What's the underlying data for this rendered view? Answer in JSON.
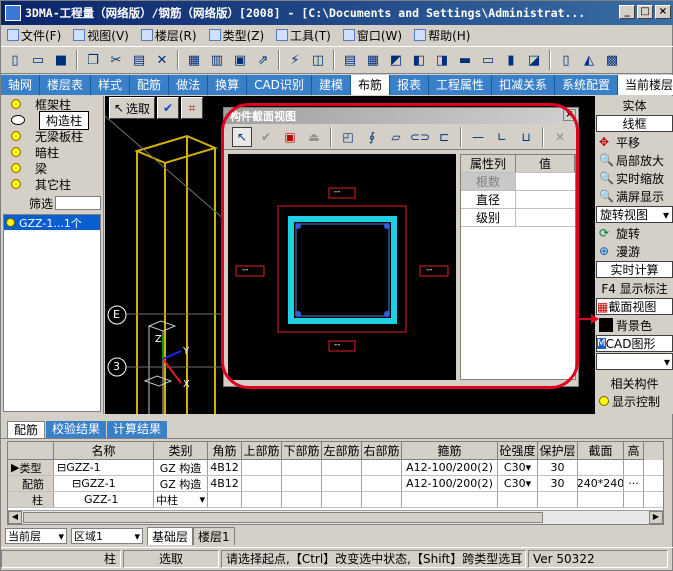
{
  "title": "3DMA-工程量（网络版）/钢筋（网络版）[2008] - [C:\\Documents and Settings\\Administrat...",
  "window_buttons": {
    "minimize": "_",
    "maximize": "□",
    "close": "×"
  },
  "menu": [
    "文件(F)",
    "视图(V)",
    "楼层(R)",
    "类型(Z)",
    "工具(T)",
    "窗口(W)",
    "帮助(H)"
  ],
  "toolbar_icons": [
    "new-icon",
    "open-icon",
    "save-icon",
    "copy-icon",
    "cut-icon",
    "paste-icon",
    "delete-icon",
    "grid-icon",
    "table-icon",
    "image-icon",
    "arrow-icon",
    "rebar-icon",
    "box-icon",
    "layer-icon",
    "building-icon",
    "door-icon",
    "wall-icon",
    "brick-icon"
  ],
  "tabs": [
    "轴网",
    "楼层表",
    "样式",
    "配筋",
    "做法",
    "换算",
    "CAD识别",
    "建模",
    "布筋",
    "报表",
    "工程属性",
    "扣减关系",
    "系统配置",
    "当前楼层"
  ],
  "active_tab": "布筋",
  "left_panel": {
    "items": [
      "框架柱",
      "构造柱",
      "无梁板柱",
      "暗柱",
      "梁",
      "其它柱"
    ],
    "selected": "构造柱",
    "filter_label": "筛选",
    "list": [
      "GZZ-1...1个"
    ]
  },
  "view": {
    "select_label": "选取",
    "labels": [
      "E",
      "3"
    ],
    "axes": {
      "x": "X",
      "y": "Y",
      "z": "Z"
    }
  },
  "dialog": {
    "title": "构件截面视图",
    "close": "×",
    "dims": [
      "--",
      "--",
      "--",
      "--"
    ],
    "prop_headers": [
      "属性列",
      "值"
    ],
    "props": [
      {
        "name": "根数",
        "value": ""
      },
      {
        "name": "直径",
        "value": ""
      },
      {
        "name": "级别",
        "value": ""
      }
    ]
  },
  "right_panel": {
    "solid": "实体",
    "wireframe": "线框",
    "pan": "平移",
    "zoom_local": "局部放大",
    "zoom_real": "实时缩放",
    "fit": "满屏显示",
    "rotate_view": "旋转视图",
    "rotate": "旋转",
    "roam": "漫游",
    "realtime_calc": "实时计算",
    "f4_label": "F4 显示标注",
    "section_view": "截面视图",
    "bg_color": "背景色",
    "cad_graph": "CAD图形",
    "related": "相关构件",
    "display_ctrl": "显示控制"
  },
  "bottom_tabs": [
    "配筋",
    "校验结果",
    "计算结果"
  ],
  "grid": {
    "headers": [
      "",
      "名称",
      "类别",
      "角筋",
      "上部筋",
      "下部筋",
      "左部筋",
      "右部筋",
      "箍筋",
      "砼强度",
      "保护层",
      "截面",
      "高"
    ],
    "rows": [
      [
        "类型",
        "⊟GZZ-1",
        "GZ 构造",
        "4B12",
        "",
        "",
        "",
        "",
        "A12-100/200(2)",
        "C30",
        "30",
        "",
        ""
      ],
      [
        "配筋",
        "⊟GZZ-1",
        "GZ 构造",
        "4B12",
        "",
        "",
        "",
        "",
        "A12-100/200(2)",
        "C30",
        "30",
        "240*240",
        "···"
      ],
      [
        "柱",
        "GZZ-1",
        "中柱",
        "",
        "",
        "",
        "",
        "",
        "",
        "",
        "",
        "",
        ""
      ]
    ]
  },
  "layer_bar": {
    "floor": "当前层",
    "area": "区域1",
    "base_layer": "基础层",
    "floor_tab": "楼层1"
  },
  "status_bar": {
    "item1": "柱",
    "item2": "选取",
    "message": "请选择起点,【Ctrl】改变选中状态,【Shift】跨类型选耳",
    "version": "Ver 50322"
  }
}
